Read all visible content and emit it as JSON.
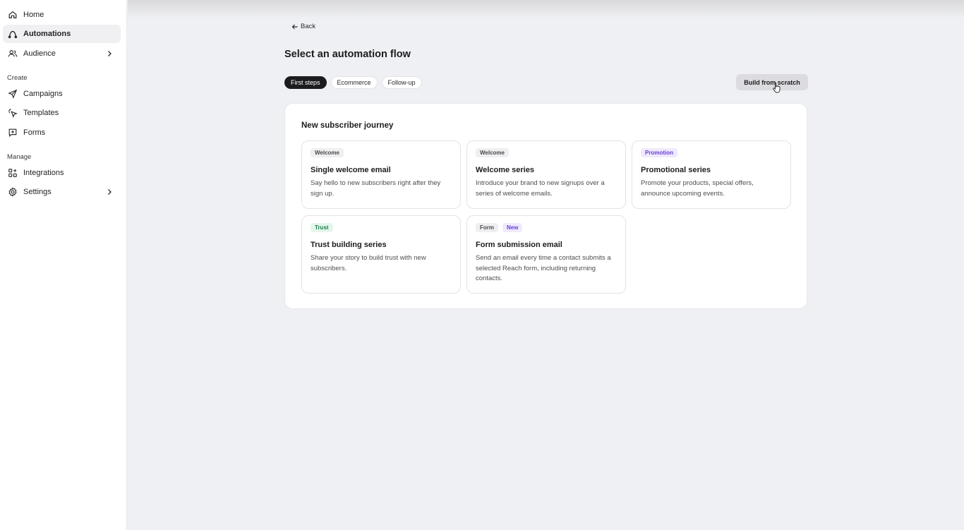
{
  "sidebar": {
    "items": [
      {
        "label": "Home",
        "icon": "home-icon"
      },
      {
        "label": "Automations",
        "icon": "automations-icon",
        "active": true
      },
      {
        "label": "Audience",
        "icon": "audience-icon"
      }
    ],
    "create_label": "Create",
    "create_items": [
      {
        "label": "Campaigns",
        "icon": "send-icon"
      },
      {
        "label": "Templates",
        "icon": "templates-icon"
      },
      {
        "label": "Forms",
        "icon": "forms-icon"
      }
    ],
    "manage_label": "Manage",
    "manage_items": [
      {
        "label": "Integrations",
        "icon": "integrations-icon"
      },
      {
        "label": "Settings",
        "icon": "gear-icon"
      }
    ]
  },
  "header": {
    "back_label": "Back",
    "title": "Select an automation flow"
  },
  "tabs": [
    {
      "label": "First steps",
      "active": true
    },
    {
      "label": "Ecommerce"
    },
    {
      "label": "Follow-up"
    }
  ],
  "actions": {
    "build_from_scratch": "Build from scratch"
  },
  "panel": {
    "title": "New subscriber journey",
    "cards": [
      {
        "badges": [
          "Welcome"
        ],
        "title": "Single welcome email",
        "description": "Say hello to new subscribers right after they sign up."
      },
      {
        "badges": [
          "Welcome"
        ],
        "title": "Welcome series",
        "description": "Introduce your brand to new signups over a series of welcome emails."
      },
      {
        "badges": [
          "Promotion"
        ],
        "title": "Promotional series",
        "description": "Promote your products, special offers, announce upcoming events."
      },
      {
        "badges": [
          "Trust"
        ],
        "title": "Trust building series",
        "description": "Share your story to build trust with new subscribers."
      },
      {
        "badges": [
          "Form",
          "New"
        ],
        "title": "Form submission email",
        "description": "Send an email every time a contact submits a selected Reach form, including returning contacts."
      }
    ]
  },
  "colors": {
    "accent_dark": "#1c1c1e",
    "background": "#eff0f3",
    "badge_purple": "#6b3fd6",
    "badge_green": "#1f7a49"
  }
}
